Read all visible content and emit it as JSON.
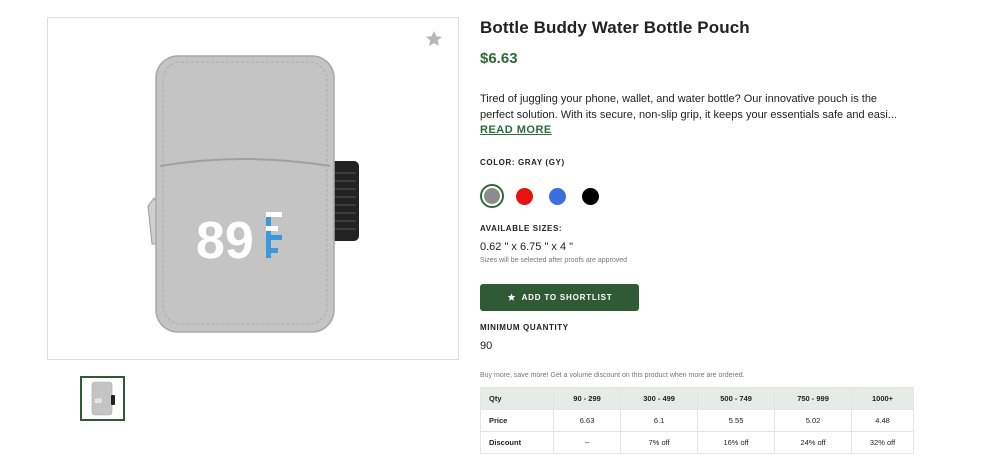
{
  "product": {
    "title": "Bottle Buddy Water Bottle Pouch",
    "price": "$6.63",
    "description_line1": "Tired of juggling your phone, wallet, and water bottle? Our innovative pouch is the",
    "description_line2": "perfect solution. With its secure, non-slip grip, it keeps your essentials safe and easi...",
    "read_more": "READ MORE",
    "image_logo_text": "89",
    "image_logo_letters": "FF"
  },
  "color": {
    "label": "COLOR: GRAY (GY)",
    "swatches": [
      {
        "name": "gray",
        "hex": "#8c8c8c",
        "selected": true
      },
      {
        "name": "red",
        "hex": "#e8120f",
        "selected": false
      },
      {
        "name": "blue",
        "hex": "#3b6fe0",
        "selected": false
      },
      {
        "name": "black",
        "hex": "#000000",
        "selected": false
      }
    ]
  },
  "sizes": {
    "label": "AVAILABLE SIZES:",
    "value": "0.62 \" x 6.75 \" x 4 \"",
    "note": "Sizes will be selected after proofs are approved"
  },
  "actions": {
    "shortlist_label": "ADD TO SHORTLIST",
    "shortlist_icon": "star-icon",
    "favorite_icon": "star-icon"
  },
  "min_quantity": {
    "label": "MINIMUM QUANTITY",
    "value": "90"
  },
  "volume": {
    "note": "Buy more, save more! Get a volume discount on this product when more are ordered.",
    "headers": [
      "Qty",
      "90 - 299",
      "300 - 499",
      "500 - 749",
      "750 - 999",
      "1000+"
    ],
    "rows": [
      [
        "Price",
        "6.63",
        "6.1",
        "5.55",
        "5.02",
        "4.48"
      ],
      [
        "Discount",
        "--",
        "7% off",
        "16% off",
        "24% off",
        "32% off"
      ]
    ]
  },
  "colors": {
    "brand_green": "#2f5a34",
    "price_green": "#2d6a3a",
    "table_header_bg": "#e5ebe6"
  }
}
